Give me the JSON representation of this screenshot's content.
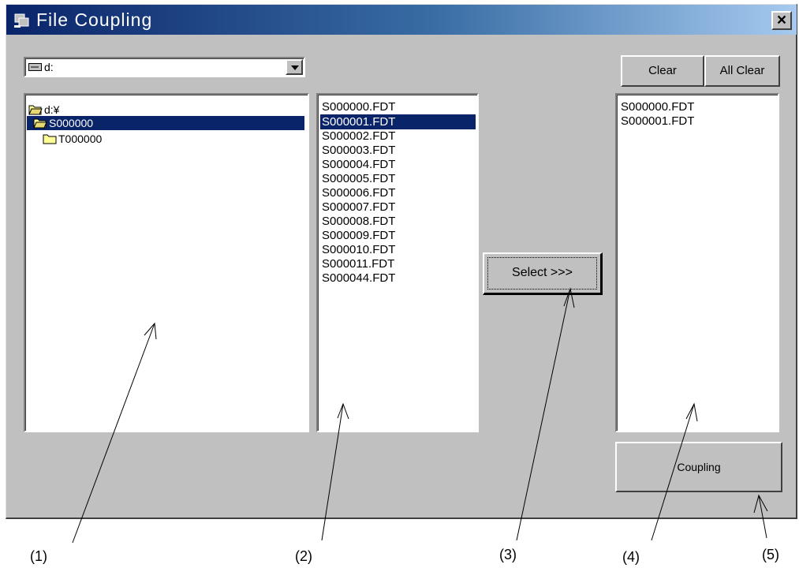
{
  "window": {
    "title": "File Coupling",
    "close_label": "×"
  },
  "drive_selector": {
    "value": "d:",
    "icon": "drive-icon"
  },
  "folder_tree": [
    {
      "label": "d:¥",
      "icon": "open-folder-icon",
      "selected": false
    },
    {
      "label": "S000000",
      "icon": "open-folder-icon",
      "selected": true
    },
    {
      "label": "T000000",
      "icon": "folder-icon",
      "selected": false
    }
  ],
  "file_list": [
    {
      "name": "S000000.FDT",
      "selected": false
    },
    {
      "name": "S000001.FDT",
      "selected": true
    },
    {
      "name": "S000002.FDT",
      "selected": false
    },
    {
      "name": "S000003.FDT",
      "selected": false
    },
    {
      "name": "S000004.FDT",
      "selected": false
    },
    {
      "name": "S000005.FDT",
      "selected": false
    },
    {
      "name": "S000006.FDT",
      "selected": false
    },
    {
      "name": "S000007.FDT",
      "selected": false
    },
    {
      "name": "S000008.FDT",
      "selected": false
    },
    {
      "name": "S000009.FDT",
      "selected": false
    },
    {
      "name": "S000010.FDT",
      "selected": false
    },
    {
      "name": "S000011.FDT",
      "selected": false
    },
    {
      "name": "S000044.FDT",
      "selected": false
    }
  ],
  "selected_files": [
    "S000000.FDT",
    "S000001.FDT"
  ],
  "buttons": {
    "select": "Select  >>>",
    "clear": "Clear",
    "all_clear": "All Clear",
    "coupling": "Coupling"
  },
  "callouts": [
    "(1)",
    "(2)",
    "(3)",
    "(4)",
    "(5)"
  ],
  "colors": {
    "dialog_face": "#c0c0c0",
    "title_gradient_start": "#0a246a",
    "title_gradient_end": "#a6caf0",
    "selection": "#0a246a"
  }
}
